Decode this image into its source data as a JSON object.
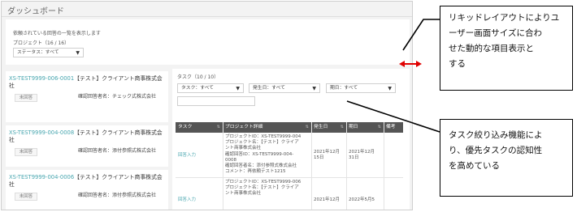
{
  "dashboard": {
    "title": "ダッシュボード",
    "description": "依頼されている回答の一覧を表示します",
    "project_count": "プロジェクト（16 / 16）",
    "status_filter": "ステータス：すべて"
  },
  "projects": [
    {
      "id": "XS-TEST9999-006-0001",
      "name": "【テスト】クライアント商事株式会社",
      "status": "未回答",
      "respondent": "確認回答者名：チェック式株式会社"
    },
    {
      "id": "XS-TEST9999-004-0008",
      "name": "【テスト】クライアント商事株式会社",
      "status": "未回答",
      "respondent": "確認回答者名：添付参照式株式会社"
    },
    {
      "id": "XS-TEST9999-004-0006",
      "name": "【テスト】クライアント商事株式会社",
      "status": "未回答",
      "respondent": "確認回答者名：添付参照式株式会社"
    }
  ],
  "tasks": {
    "count": "タスク（10 / 10）",
    "filters": [
      "タスク：すべて",
      "発生日：すべて",
      "期日：すべて"
    ],
    "columns": [
      "タスク",
      "プロジェクト詳細",
      "発生日",
      "期日",
      "備考"
    ],
    "rows": [
      {
        "task": "回答入力",
        "details": [
          "プロジェクトID：XS-TEST9999-004",
          "プロジェクト名：【テスト】クライア",
          "ント商事株式会社",
          "確認回答ID：XS-TEST9999-004-",
          "0008",
          "確認回答者名：添付参照式株式会社",
          "コメント：再依頼テスト1215"
        ],
        "occurred": [
          "2021年12月",
          "15日"
        ],
        "due": [
          "2021年12月",
          "31日"
        ],
        "note": ""
      },
      {
        "task": "回答入力",
        "details": [
          "プロジェクトID：XS-TEST9999-006",
          "プロジェクト名：【テスト】クライア",
          "ント商事株式会社"
        ],
        "occurred": [
          "2021年12月"
        ],
        "due": [
          "2022年5月5"
        ],
        "note": ""
      }
    ]
  },
  "annotations": {
    "liquid_layout": [
      "リキッドレイアウトによりユ",
      "ーザー画面サイズに合わ",
      "せた動的な項目表示と",
      "する"
    ],
    "task_filter": [
      "タスク絞り込み機能によ",
      "り、優先タスクの認知性",
      "を高めている"
    ]
  },
  "colors": {
    "link": "#4aa7b0",
    "table_header": "#555555",
    "arrow": "#e00000"
  }
}
